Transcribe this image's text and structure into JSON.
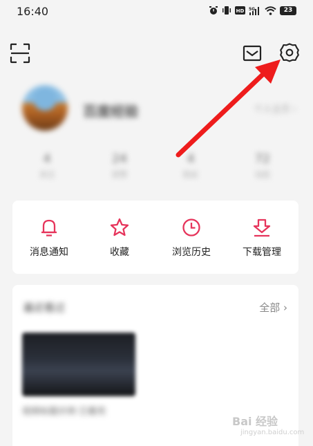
{
  "status_bar": {
    "time": "16:40",
    "battery": "23"
  },
  "header": {
    "icons": [
      "scan-icon",
      "mail-icon",
      "settings-gear-icon"
    ]
  },
  "profile": {
    "username": "百度经验",
    "profile_link": "个人主页 ›",
    "stats": [
      {
        "num": "4",
        "label": "关注"
      },
      {
        "num": "24",
        "label": "获赞"
      },
      {
        "num": "4",
        "label": "粉丝"
      },
      {
        "num": "72",
        "label": "动态"
      }
    ]
  },
  "actions": [
    {
      "label": "消息通知",
      "icon": "bell-icon"
    },
    {
      "label": "收藏",
      "icon": "star-icon"
    },
    {
      "label": "浏览历史",
      "icon": "clock-icon"
    },
    {
      "label": "下载管理",
      "icon": "download-icon"
    }
  ],
  "recent": {
    "title": "最近看过",
    "all_label": "全部 ›",
    "video_caption": "视频标题示例 已看完"
  },
  "watermark": {
    "text": "Bai 经验",
    "sub": "jingyan.baidu.com"
  },
  "colors": {
    "accent": "#e6345b",
    "annotation_arrow": "#ee1c1c"
  }
}
